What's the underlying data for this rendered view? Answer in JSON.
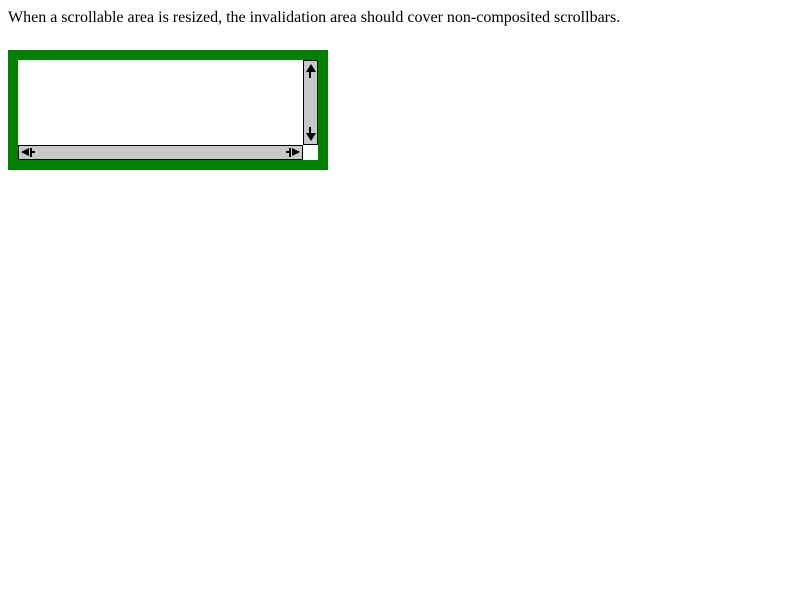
{
  "description": {
    "text": "When a scrollable area is resized, the invalidation area should cover non-composited scrollbars."
  },
  "colors": {
    "frame_border": "#008000",
    "scrollbar_track": "#c8c8c8",
    "scrollbar_outline": "#000000",
    "background": "#ffffff"
  },
  "icons": {
    "scroll_up": "arrow-up-icon",
    "scroll_down": "arrow-down-icon",
    "scroll_left": "arrow-left-icon",
    "scroll_right": "arrow-right-icon"
  }
}
